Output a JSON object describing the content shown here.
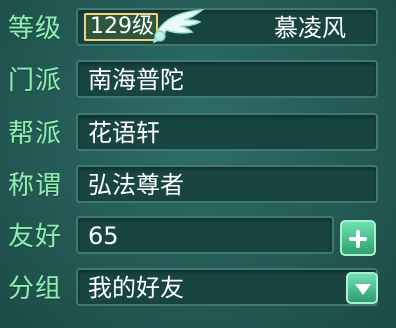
{
  "rows": {
    "level": {
      "label": "等级",
      "value": "129级",
      "name": "慕凌风"
    },
    "sect": {
      "label": "门派",
      "value": "南海普陀"
    },
    "gang": {
      "label": "帮派",
      "value": "花语轩"
    },
    "title": {
      "label": "称谓",
      "value": "弘法尊者"
    },
    "friendship": {
      "label": "友好",
      "value": "65"
    },
    "group": {
      "label": "分组",
      "value": "我的好友"
    }
  },
  "icons": {
    "wing": "wing-icon",
    "plus": "plus-icon",
    "dropdown": "chevron-down-icon"
  },
  "colors": {
    "label": "#8ff0b0",
    "panel_bg": "#245a55",
    "field_bg": "#184542",
    "accent": "#2fa070",
    "level_border": "#f1d27a"
  }
}
